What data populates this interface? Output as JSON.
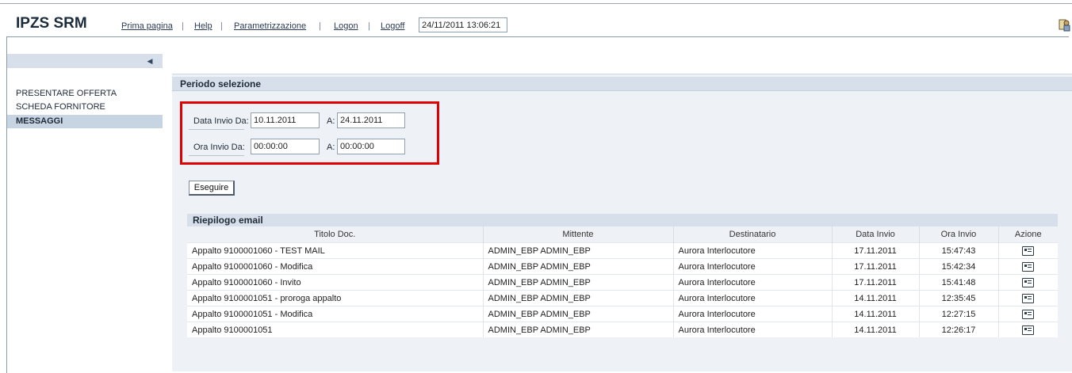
{
  "header": {
    "app_name": "IPZS SRM",
    "nav": [
      "Prima pagina",
      "Help",
      "Parametrizzazione",
      "Logon",
      "Logoff"
    ],
    "separator": "|",
    "datetime": "24/11/2011 13:06:21"
  },
  "sidebar": {
    "collapse_icon": "triangle-left-icon",
    "items": [
      {
        "label": "PRESENTARE OFFERTA",
        "active": false
      },
      {
        "label": "SCHEDA FORNITORE",
        "active": false
      },
      {
        "label": "MESSAGGI",
        "active": true
      }
    ]
  },
  "selection": {
    "title": "Periodo selezione",
    "date_from_label": "Data Invio Da:",
    "date_from": "10.11.2011",
    "date_to_label": "A:",
    "date_to": "24.11.2011",
    "time_from_label": "Ora Invio Da:",
    "time_from": "00:00:00",
    "time_to_label": "A:",
    "time_to": "00:00:00",
    "highlight_color": "#e00000"
  },
  "run_button": "Eseguire",
  "emails": {
    "title": "Riepilogo email",
    "columns": [
      "Titolo Doc.",
      "Mittente",
      "Destinatario",
      "Data Invio",
      "Ora Invio",
      "Azione"
    ],
    "action_icon": "mail-icon",
    "rows": [
      [
        "Appalto 9100001060 - TEST MAIL",
        "ADMIN_EBP ADMIN_EBP",
        "Aurora Interlocutore",
        "17.11.2011",
        "15:47:43"
      ],
      [
        "Appalto 9100001060 - Modifica",
        "ADMIN_EBP ADMIN_EBP",
        "Aurora Interlocutore",
        "17.11.2011",
        "15:42:34"
      ],
      [
        "Appalto 9100001060 - Invito",
        "ADMIN_EBP ADMIN_EBP",
        "Aurora Interlocutore",
        "17.11.2011",
        "15:41:48"
      ],
      [
        "Appalto 9100001051 - proroga appalto",
        "ADMIN_EBP ADMIN_EBP",
        "Aurora Interlocutore",
        "14.11.2011",
        "12:35:45"
      ],
      [
        "Appalto 9100001051 - Modifica",
        "ADMIN_EBP ADMIN_EBP",
        "Aurora Interlocutore",
        "14.11.2011",
        "12:27:15"
      ],
      [
        "Appalto 9100001051",
        "ADMIN_EBP ADMIN_EBP",
        "Aurora Interlocutore",
        "14.11.2011",
        "12:26:17"
      ]
    ]
  }
}
